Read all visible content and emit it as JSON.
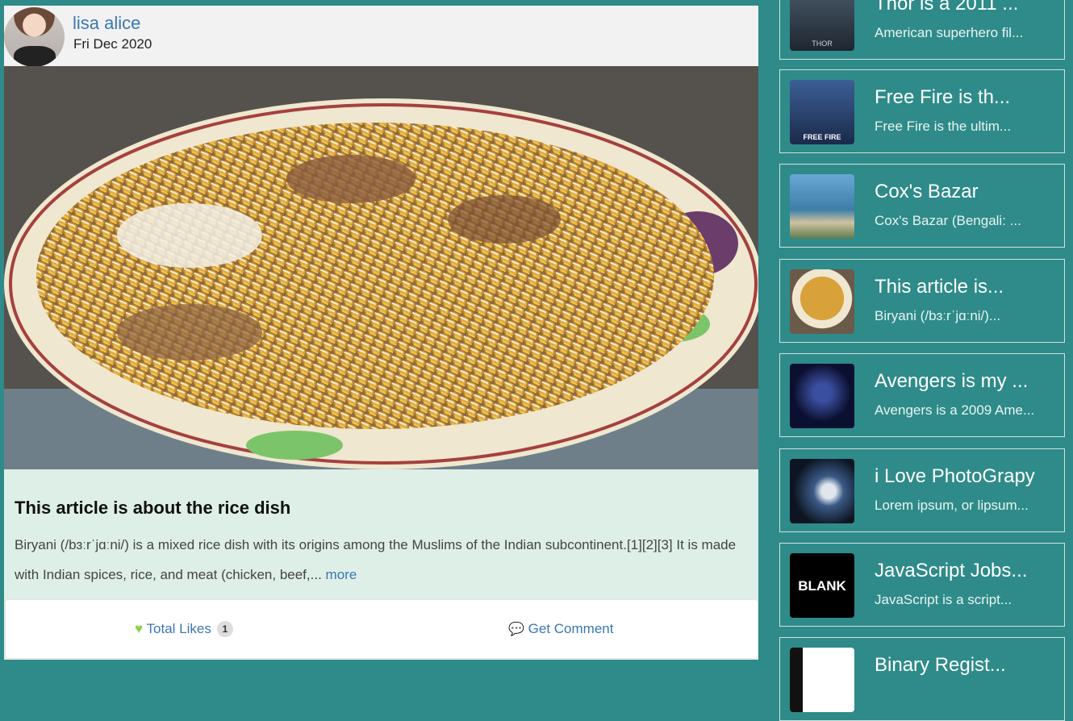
{
  "post": {
    "author": "lisa alice",
    "date": "Fri Dec 2020",
    "title": "This article is about the rice dish",
    "text": "Biryani (/bɜːrˈjɑːni/) is a mixed rice dish with its origins among the Muslims of the Indian subcontinent.[1][2][3] It is made with Indian spices, rice, and meat (chicken, beef,...",
    "more_label": "more",
    "likes_label": "Total Likes",
    "likes_count": "1",
    "comment_label": "Get Comment"
  },
  "sidebar": {
    "items": [
      {
        "title": "Thor is a 2011 ...",
        "subtitle": "American superhero fil..."
      },
      {
        "title": "Free Fire is th...",
        "subtitle": "Free Fire is the ultim..."
      },
      {
        "title": "Cox's Bazar",
        "subtitle": "Cox's Bazar (Bengali: ..."
      },
      {
        "title": "This article is...",
        "subtitle": "Biryani (/bɜːrˈjɑːni/)..."
      },
      {
        "title": "Avengers is my ...",
        "subtitle": "Avengers is a 2009 Ame..."
      },
      {
        "title": "i Love PhotoGrapy",
        "subtitle": "Lorem ipsum, or lipsum..."
      },
      {
        "title": "JavaScript Jobs...",
        "subtitle": "JavaScript is a script..."
      },
      {
        "title": "Binary Regist...",
        "subtitle": ""
      }
    ],
    "thumb_texts": {
      "free_fire": "FREE FIRE",
      "blank": "BLANK",
      "thor": "THOR"
    }
  },
  "colors": {
    "accent": "#2e8b89",
    "link": "#3a77b4",
    "heart": "#8bd14a"
  }
}
